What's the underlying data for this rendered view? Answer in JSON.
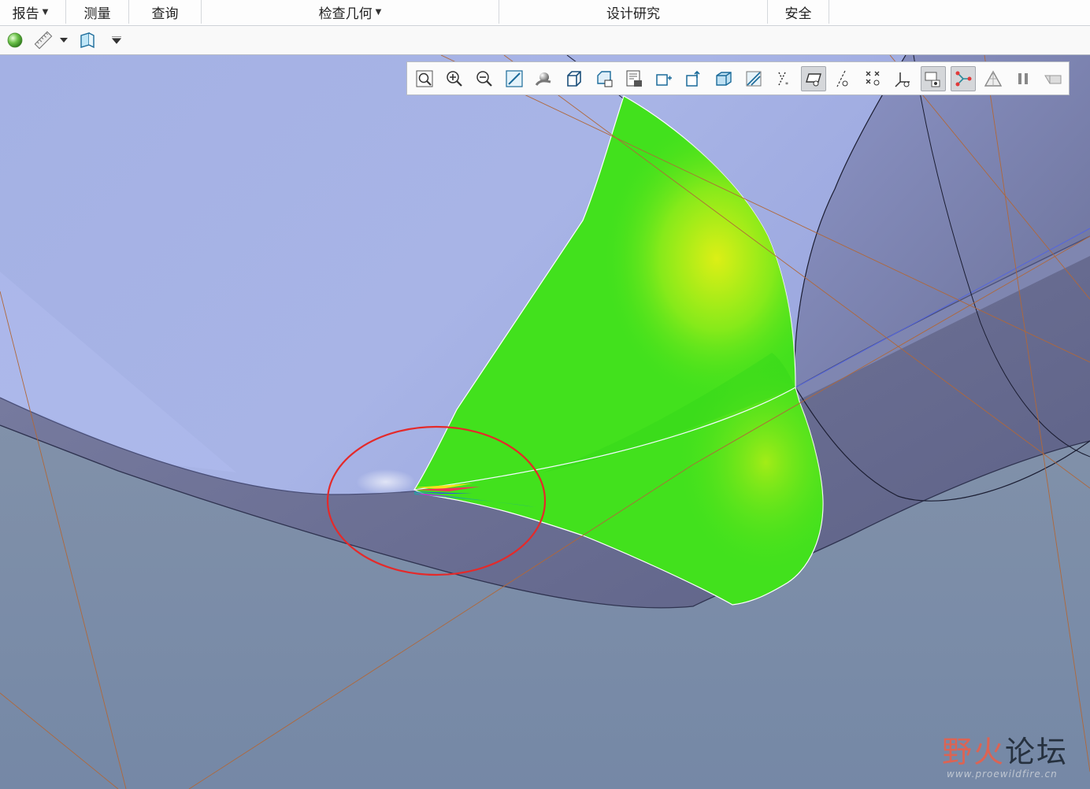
{
  "ribbon": {
    "groups": [
      {
        "label": "报告",
        "dropdown": true
      },
      {
        "label": "测量",
        "dropdown": false
      },
      {
        "label": "查询",
        "dropdown": false
      },
      {
        "label": "检查几何",
        "dropdown": true
      },
      {
        "label": "设计研究",
        "dropdown": false
      },
      {
        "label": "安全",
        "dropdown": false
      }
    ]
  },
  "quick_toolbar": {
    "icons": [
      "appearance-sphere-icon",
      "measure-ruler-icon",
      "dropdown-caret-icon",
      "cross-section-icon",
      "customize-caret-icon"
    ]
  },
  "view_toolbar": {
    "icons": [
      "refit-icon",
      "zoom-in-icon",
      "zoom-out-icon",
      "reorient-icon",
      "display-style-icon",
      "saved-orientations-icon",
      "named-views-icon",
      "view-manager-icon",
      "spin-center-icon",
      "annotation-icon",
      "perspective-icon",
      "section-icon",
      "datum-planes-icon",
      "datum-axes-icon",
      "datum-points-icon",
      "coordinate-system-icon",
      "glyph-display-icon",
      "connection-display-icon",
      "triangle-mesh-icon",
      "pause-icon",
      "shaded-model-icon"
    ],
    "active": [
      "datum-planes-icon",
      "glyph-display-icon",
      "connection-display-icon"
    ]
  },
  "colors": {
    "upper_surface": "#a3b1e4",
    "lower_surface": "#8494ab",
    "fillet_band": "#666a8e",
    "analysis_green": "#3de11d",
    "analysis_yellow": "#e4ee14",
    "highlight_circle": "#e42a2a",
    "datum_line": "#b76d3a"
  },
  "watermark": {
    "title_accent": "野火",
    "title_rest": "论坛",
    "url": "www.proewildfire.cn"
  }
}
